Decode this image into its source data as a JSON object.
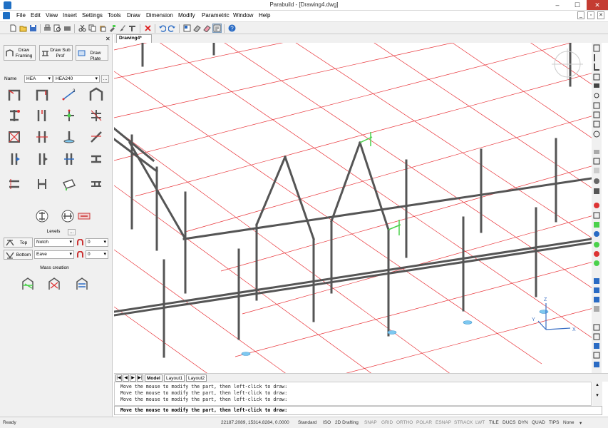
{
  "window": {
    "title": "Parabuild - [Drawing4.dwg]",
    "minimize": "–",
    "maximize": "☐",
    "close": "✕"
  },
  "menu": [
    "File",
    "Edit",
    "View",
    "Insert",
    "Settings",
    "Tools",
    "Draw",
    "Dimension",
    "Modify",
    "Parametric",
    "Window",
    "Help"
  ],
  "mdi_controls": [
    "_",
    "▫",
    "✕"
  ],
  "toolbar": {
    "icons": [
      "new-file-icon",
      "open-icon",
      "save-icon",
      "print-icon",
      "print-preview-icon",
      "plot-icon",
      "cut-icon",
      "copy-icon",
      "paste-icon",
      "match-properties-icon",
      "paintbrush-icon",
      "delete-icon",
      "undo-icon",
      "redo-icon",
      "layer-icon",
      "eraser-icon",
      "erase-icon",
      "properties-icon",
      "help-icon"
    ]
  },
  "panel": {
    "close": "✕",
    "buttons": {
      "draw_framing": [
        "Draw",
        "Framing"
      ],
      "draw_sub_prof": [
        "Draw Sub",
        "Prof"
      ],
      "draw_plate": "Draw Plate"
    },
    "name_label": "Name",
    "profile_type": "HEA",
    "profile_size": "HEA240",
    "browse": "...",
    "levels_label": "Levels",
    "levels_btn": "...",
    "top_label": "Top",
    "top_mode": "Notch",
    "top_value": "0",
    "bottom_label": "Bottom",
    "bottom_mode": "Eave",
    "bottom_value": "0",
    "mass_creation_label": "Mass creation"
  },
  "document_tab": "Drawing4*",
  "layout_tabs": {
    "nav": [
      "|◀",
      "◀",
      "▶",
      "▶|"
    ],
    "model": "Model",
    "layout1": "Layout1",
    "layout2": "Layout2"
  },
  "ucs": {
    "z": "Z",
    "y": "Y",
    "x": "X"
  },
  "command_history": [
    "Move the mouse to modify the part, then left-click to draw:",
    "Move the mouse to modify the part, then left-click to draw:",
    "Move the mouse to modify the part, then left-click to draw:"
  ],
  "command_input": "Move the mouse to modify the part, then left-click to draw:",
  "status": {
    "ready": "Ready",
    "coordinates": "22187.2089, 15314.8284, 0.0000",
    "text_style": "Standard",
    "dim_style": "ISO",
    "workspace": "2D Drafting",
    "toggles": [
      "SNAP",
      "GRID",
      "ORTHO",
      "POLAR",
      "ESNAP",
      "STRACK",
      "LWT",
      "TILE",
      "DUCS",
      "DYN",
      "QUAD",
      "TIPS"
    ],
    "toggles_on": [
      "TILE",
      "DUCS",
      "DYN",
      "QUAD",
      "TIPS"
    ],
    "annotation": "None"
  },
  "colors": {
    "grid": "#e8353a",
    "steel": "#555555",
    "highlight": "#4bd14b",
    "base_marker": "#7ec8f0",
    "accent": "#1e6fc4"
  }
}
